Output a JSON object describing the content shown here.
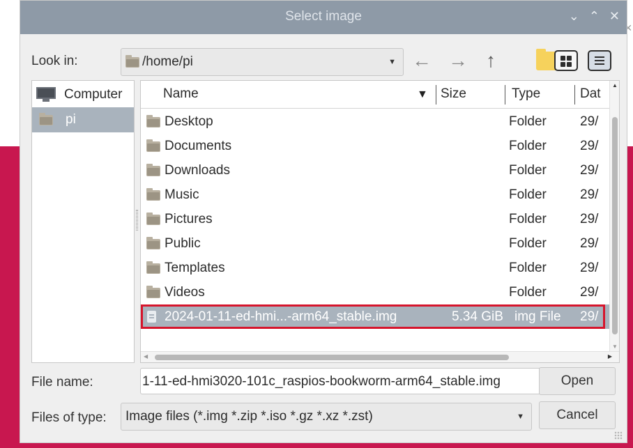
{
  "dialog": {
    "title": "Select image",
    "titlebar_buttons": {
      "minimize": "⌄",
      "maximize": "⌃",
      "close": "✕"
    }
  },
  "look_in": {
    "label": "Look in:",
    "value": "/home/pi"
  },
  "toolbar": {
    "back": "←",
    "forward": "→",
    "up": "↑"
  },
  "sidebar": {
    "items": [
      {
        "label": "Computer",
        "icon": "computer-icon"
      },
      {
        "label": "pi",
        "icon": "folder-icon",
        "selected": true
      }
    ]
  },
  "filelist": {
    "columns": [
      "Name",
      "Size",
      "Type",
      "Dat"
    ],
    "rows": [
      {
        "name": "Desktop",
        "size": "",
        "type": "Folder",
        "date": "29/"
      },
      {
        "name": "Documents",
        "size": "",
        "type": "Folder",
        "date": "29/"
      },
      {
        "name": "Downloads",
        "size": "",
        "type": "Folder",
        "date": "29/"
      },
      {
        "name": "Music",
        "size": "",
        "type": "Folder",
        "date": "29/"
      },
      {
        "name": "Pictures",
        "size": "",
        "type": "Folder",
        "date": "29/"
      },
      {
        "name": "Public",
        "size": "",
        "type": "Folder",
        "date": "29/"
      },
      {
        "name": "Templates",
        "size": "",
        "type": "Folder",
        "date": "29/"
      },
      {
        "name": "Videos",
        "size": "",
        "type": "Folder",
        "date": "29/"
      },
      {
        "name": "2024-01-11-ed-hmi...-arm64_stable.img",
        "size": "5.34 GiB",
        "type": "img File",
        "date": "29/",
        "selected": true
      }
    ]
  },
  "file_name": {
    "label": "File name:",
    "value": "1-11-ed-hmi3020-101c_raspios-bookworm-arm64_stable.img"
  },
  "files_of_type": {
    "label": "Files of type:",
    "value": "Image files (*.img *.zip *.iso *.gz *.xz *.zst)"
  },
  "buttons": {
    "open": "Open",
    "cancel": "Cancel"
  },
  "background": {
    "close_glyph": "×"
  },
  "colors": {
    "titlebar": "#8e9aa7",
    "selection": "#a9b3bd",
    "highlight_outline": "#d6152c",
    "background_accent": "#c8174f",
    "new_folder": "#f6d25c"
  }
}
